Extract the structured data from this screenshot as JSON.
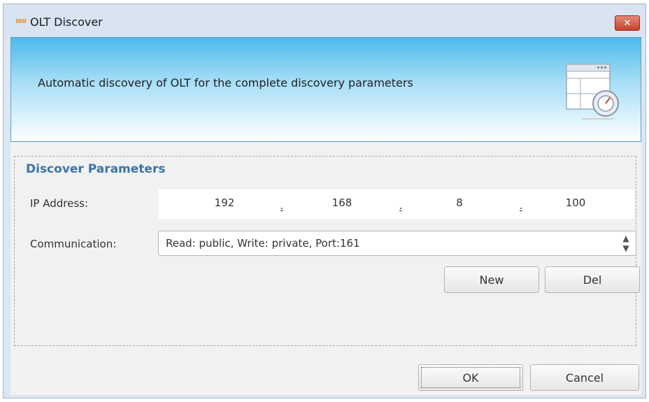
{
  "window": {
    "title": "OLT Discover",
    "close_label": "✕"
  },
  "banner": {
    "text": "Automatic discovery of OLT for the complete discovery parameters",
    "icon": "discover-wizard-icon"
  },
  "parameters": {
    "legend": "Discover Parameters",
    "ip_label": "IP Address:",
    "ip_octets": [
      "192",
      "168",
      "8",
      "100"
    ],
    "ip_separator": ".",
    "communication_label": "Communication:",
    "communication_value": "Read: public, Write: private, Port:161",
    "new_label": "New",
    "del_label": "Del"
  },
  "footer": {
    "ok_label": "OK",
    "cancel_label": "Cancel"
  },
  "colors": {
    "legend": "#3b74a8",
    "banner_top": "#4cb9ea",
    "close_button": "#c5432c"
  }
}
